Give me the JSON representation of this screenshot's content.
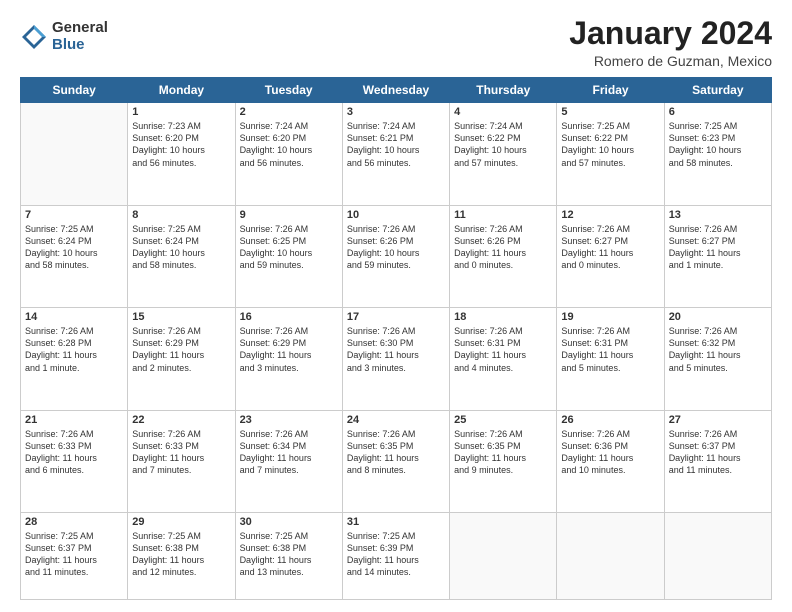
{
  "logo": {
    "general": "General",
    "blue": "Blue"
  },
  "title": "January 2024",
  "subtitle": "Romero de Guzman, Mexico",
  "days_of_week": [
    "Sunday",
    "Monday",
    "Tuesday",
    "Wednesday",
    "Thursday",
    "Friday",
    "Saturday"
  ],
  "weeks": [
    [
      {
        "num": "",
        "info": ""
      },
      {
        "num": "1",
        "info": "Sunrise: 7:23 AM\nSunset: 6:20 PM\nDaylight: 10 hours\nand 56 minutes."
      },
      {
        "num": "2",
        "info": "Sunrise: 7:24 AM\nSunset: 6:20 PM\nDaylight: 10 hours\nand 56 minutes."
      },
      {
        "num": "3",
        "info": "Sunrise: 7:24 AM\nSunset: 6:21 PM\nDaylight: 10 hours\nand 56 minutes."
      },
      {
        "num": "4",
        "info": "Sunrise: 7:24 AM\nSunset: 6:22 PM\nDaylight: 10 hours\nand 57 minutes."
      },
      {
        "num": "5",
        "info": "Sunrise: 7:25 AM\nSunset: 6:22 PM\nDaylight: 10 hours\nand 57 minutes."
      },
      {
        "num": "6",
        "info": "Sunrise: 7:25 AM\nSunset: 6:23 PM\nDaylight: 10 hours\nand 58 minutes."
      }
    ],
    [
      {
        "num": "7",
        "info": "Sunrise: 7:25 AM\nSunset: 6:24 PM\nDaylight: 10 hours\nand 58 minutes."
      },
      {
        "num": "8",
        "info": "Sunrise: 7:25 AM\nSunset: 6:24 PM\nDaylight: 10 hours\nand 58 minutes."
      },
      {
        "num": "9",
        "info": "Sunrise: 7:26 AM\nSunset: 6:25 PM\nDaylight: 10 hours\nand 59 minutes."
      },
      {
        "num": "10",
        "info": "Sunrise: 7:26 AM\nSunset: 6:26 PM\nDaylight: 10 hours\nand 59 minutes."
      },
      {
        "num": "11",
        "info": "Sunrise: 7:26 AM\nSunset: 6:26 PM\nDaylight: 11 hours\nand 0 minutes."
      },
      {
        "num": "12",
        "info": "Sunrise: 7:26 AM\nSunset: 6:27 PM\nDaylight: 11 hours\nand 0 minutes."
      },
      {
        "num": "13",
        "info": "Sunrise: 7:26 AM\nSunset: 6:27 PM\nDaylight: 11 hours\nand 1 minute."
      }
    ],
    [
      {
        "num": "14",
        "info": "Sunrise: 7:26 AM\nSunset: 6:28 PM\nDaylight: 11 hours\nand 1 minute."
      },
      {
        "num": "15",
        "info": "Sunrise: 7:26 AM\nSunset: 6:29 PM\nDaylight: 11 hours\nand 2 minutes."
      },
      {
        "num": "16",
        "info": "Sunrise: 7:26 AM\nSunset: 6:29 PM\nDaylight: 11 hours\nand 3 minutes."
      },
      {
        "num": "17",
        "info": "Sunrise: 7:26 AM\nSunset: 6:30 PM\nDaylight: 11 hours\nand 3 minutes."
      },
      {
        "num": "18",
        "info": "Sunrise: 7:26 AM\nSunset: 6:31 PM\nDaylight: 11 hours\nand 4 minutes."
      },
      {
        "num": "19",
        "info": "Sunrise: 7:26 AM\nSunset: 6:31 PM\nDaylight: 11 hours\nand 5 minutes."
      },
      {
        "num": "20",
        "info": "Sunrise: 7:26 AM\nSunset: 6:32 PM\nDaylight: 11 hours\nand 5 minutes."
      }
    ],
    [
      {
        "num": "21",
        "info": "Sunrise: 7:26 AM\nSunset: 6:33 PM\nDaylight: 11 hours\nand 6 minutes."
      },
      {
        "num": "22",
        "info": "Sunrise: 7:26 AM\nSunset: 6:33 PM\nDaylight: 11 hours\nand 7 minutes."
      },
      {
        "num": "23",
        "info": "Sunrise: 7:26 AM\nSunset: 6:34 PM\nDaylight: 11 hours\nand 7 minutes."
      },
      {
        "num": "24",
        "info": "Sunrise: 7:26 AM\nSunset: 6:35 PM\nDaylight: 11 hours\nand 8 minutes."
      },
      {
        "num": "25",
        "info": "Sunrise: 7:26 AM\nSunset: 6:35 PM\nDaylight: 11 hours\nand 9 minutes."
      },
      {
        "num": "26",
        "info": "Sunrise: 7:26 AM\nSunset: 6:36 PM\nDaylight: 11 hours\nand 10 minutes."
      },
      {
        "num": "27",
        "info": "Sunrise: 7:26 AM\nSunset: 6:37 PM\nDaylight: 11 hours\nand 11 minutes."
      }
    ],
    [
      {
        "num": "28",
        "info": "Sunrise: 7:25 AM\nSunset: 6:37 PM\nDaylight: 11 hours\nand 11 minutes."
      },
      {
        "num": "29",
        "info": "Sunrise: 7:25 AM\nSunset: 6:38 PM\nDaylight: 11 hours\nand 12 minutes."
      },
      {
        "num": "30",
        "info": "Sunrise: 7:25 AM\nSunset: 6:38 PM\nDaylight: 11 hours\nand 13 minutes."
      },
      {
        "num": "31",
        "info": "Sunrise: 7:25 AM\nSunset: 6:39 PM\nDaylight: 11 hours\nand 14 minutes."
      },
      {
        "num": "",
        "info": ""
      },
      {
        "num": "",
        "info": ""
      },
      {
        "num": "",
        "info": ""
      }
    ]
  ]
}
